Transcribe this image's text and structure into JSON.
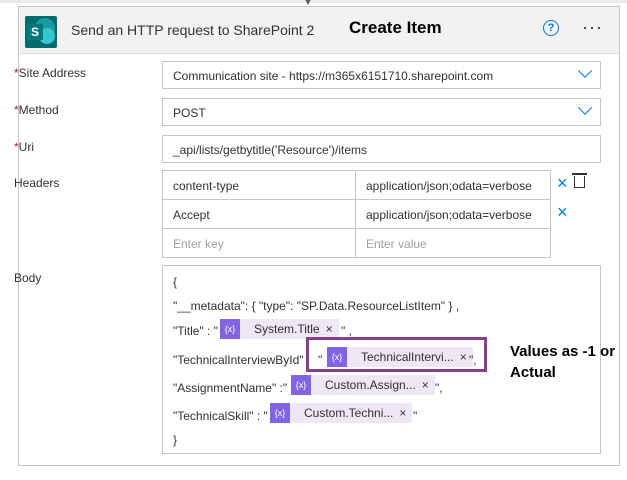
{
  "header": {
    "title": "Send an HTTP request to SharePoint 2",
    "overlay_text": "Create Item",
    "help_glyph": "?",
    "more_glyph": "···"
  },
  "fields": {
    "site_address": {
      "label": "Site Address",
      "value": "Communication site - https://m365x6151710.sharepoint.com"
    },
    "method": {
      "label": "Method",
      "value": "POST"
    },
    "uri": {
      "label": "Uri",
      "value": "_api/lists/getbytitle('Resource')/items"
    }
  },
  "required_mark": "*",
  "headers": {
    "label": "Headers",
    "rows": [
      {
        "key": "content-type",
        "value": "application/json;odata=verbose"
      },
      {
        "key": "Accept",
        "value": "application/json;odata=verbose"
      }
    ],
    "key_placeholder": "Enter key",
    "value_placeholder": "Enter value"
  },
  "body": {
    "label": "Body",
    "open_brace": "{",
    "metadata_line": "\"__metadata\": { \"type\": \"SP.Data.ResourceListItem\" } ,",
    "title_key": "\"Title\" : \"",
    "title_token": "System.Title",
    "title_end": "\" ,",
    "interview_key": "\"TechnicalInterviewById\"",
    "interview_pre": "\"",
    "interview_token": "TechnicalIntervi...",
    "interview_end": "\",",
    "assignment_key": "\"AssignmentName\" :\"",
    "assignment_token": "Custom.Assign...",
    "assignment_end": "\",",
    "skill_key": "\"TechnicalSkill\" : \"",
    "skill_token": "Custom.Techni...",
    "skill_end": "\"",
    "close_brace": "}",
    "token_icon": "{x}",
    "token_remove": "×"
  },
  "annotation": {
    "line1": "Values as -1 or",
    "line2": "Actual"
  },
  "colors": {
    "accent": "#0078d4",
    "token_icon": "#8164e3",
    "highlight_border": "#8b3d8e",
    "sharepoint": "#036c70"
  }
}
